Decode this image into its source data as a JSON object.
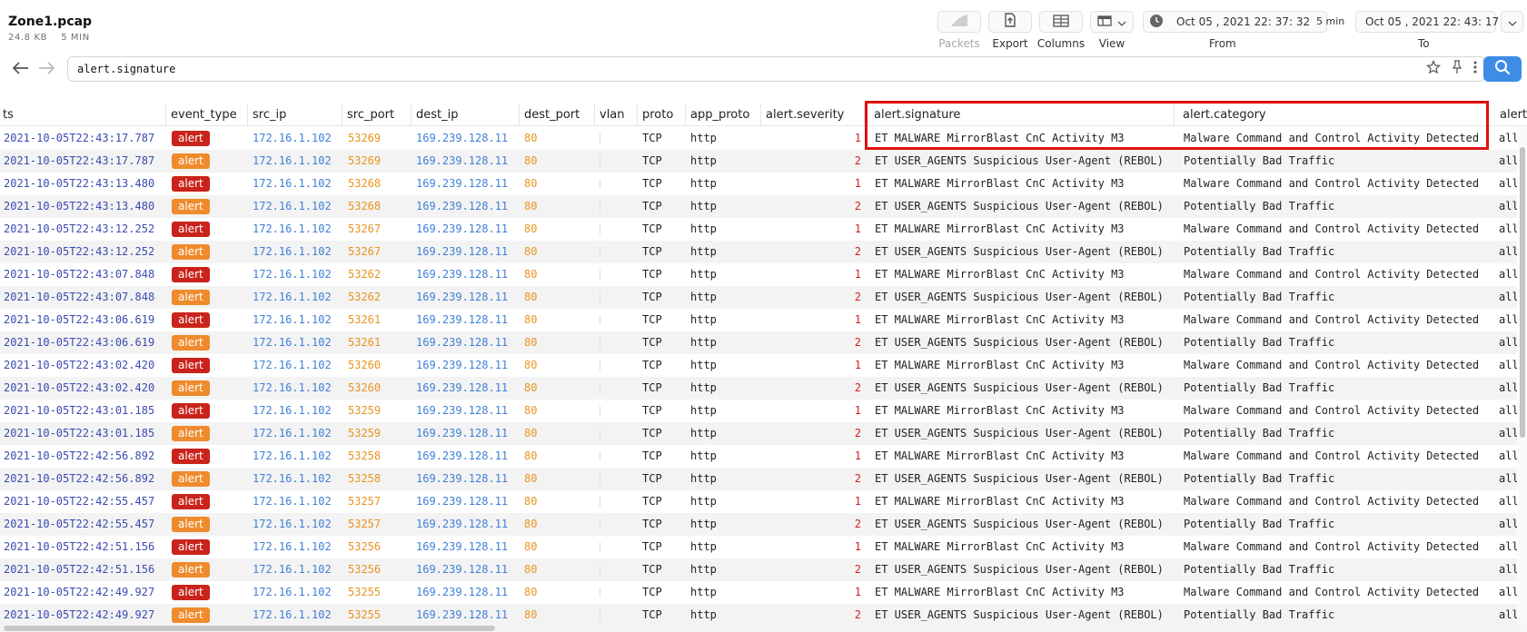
{
  "file": {
    "title": "Zone1.pcap",
    "size": "24.8 KB",
    "duration": "5 MIN"
  },
  "toolbar": {
    "packets_label": "Packets",
    "export_label": "Export",
    "columns_label": "Columns",
    "view_label": "View",
    "from_value": "Oct 05 , 2021  22: 37: 32",
    "duration_value": "5 min",
    "to_value": "Oct 05 , 2021  22: 43: 17",
    "from_label": "From",
    "to_label": "To"
  },
  "search": {
    "query": "alert.signature"
  },
  "table": {
    "columns": [
      "ts",
      "event_type",
      "src_ip",
      "src_port",
      "dest_ip",
      "dest_port",
      "vlan",
      "proto",
      "app_proto",
      "alert.severity",
      "alert.signature",
      "alert.category",
      "alert"
    ],
    "colors": {
      "sev1_badge": "#c9231b",
      "sev2_badge": "#ef8b2c",
      "highlight": "#e01010"
    },
    "rows": [
      {
        "ts": "2021-10-05T22:43:17.787",
        "event_type": "alert",
        "src_ip": "172.16.1.102",
        "src_port": "53269",
        "dest_ip": "169.239.128.11",
        "dest_port": "80",
        "vlan": "",
        "proto": "TCP",
        "app_proto": "http",
        "severity": "1",
        "signature": "ET MALWARE MirrorBlast CnC Activity M3",
        "category": "Malware Command and Control Activity Detected",
        "alert_more": "all"
      },
      {
        "ts": "2021-10-05T22:43:17.787",
        "event_type": "alert",
        "src_ip": "172.16.1.102",
        "src_port": "53269",
        "dest_ip": "169.239.128.11",
        "dest_port": "80",
        "vlan": "",
        "proto": "TCP",
        "app_proto": "http",
        "severity": "2",
        "signature": "ET USER_AGENTS Suspicious User-Agent (REBOL)",
        "category": "Potentially Bad Traffic",
        "alert_more": "all"
      },
      {
        "ts": "2021-10-05T22:43:13.480",
        "event_type": "alert",
        "src_ip": "172.16.1.102",
        "src_port": "53268",
        "dest_ip": "169.239.128.11",
        "dest_port": "80",
        "vlan": "",
        "proto": "TCP",
        "app_proto": "http",
        "severity": "1",
        "signature": "ET MALWARE MirrorBlast CnC Activity M3",
        "category": "Malware Command and Control Activity Detected",
        "alert_more": "all"
      },
      {
        "ts": "2021-10-05T22:43:13.480",
        "event_type": "alert",
        "src_ip": "172.16.1.102",
        "src_port": "53268",
        "dest_ip": "169.239.128.11",
        "dest_port": "80",
        "vlan": "",
        "proto": "TCP",
        "app_proto": "http",
        "severity": "2",
        "signature": "ET USER_AGENTS Suspicious User-Agent (REBOL)",
        "category": "Potentially Bad Traffic",
        "alert_more": "all"
      },
      {
        "ts": "2021-10-05T22:43:12.252",
        "event_type": "alert",
        "src_ip": "172.16.1.102",
        "src_port": "53267",
        "dest_ip": "169.239.128.11",
        "dest_port": "80",
        "vlan": "",
        "proto": "TCP",
        "app_proto": "http",
        "severity": "1",
        "signature": "ET MALWARE MirrorBlast CnC Activity M3",
        "category": "Malware Command and Control Activity Detected",
        "alert_more": "all"
      },
      {
        "ts": "2021-10-05T22:43:12.252",
        "event_type": "alert",
        "src_ip": "172.16.1.102",
        "src_port": "53267",
        "dest_ip": "169.239.128.11",
        "dest_port": "80",
        "vlan": "",
        "proto": "TCP",
        "app_proto": "http",
        "severity": "2",
        "signature": "ET USER_AGENTS Suspicious User-Agent (REBOL)",
        "category": "Potentially Bad Traffic",
        "alert_more": "all"
      },
      {
        "ts": "2021-10-05T22:43:07.848",
        "event_type": "alert",
        "src_ip": "172.16.1.102",
        "src_port": "53262",
        "dest_ip": "169.239.128.11",
        "dest_port": "80",
        "vlan": "",
        "proto": "TCP",
        "app_proto": "http",
        "severity": "1",
        "signature": "ET MALWARE MirrorBlast CnC Activity M3",
        "category": "Malware Command and Control Activity Detected",
        "alert_more": "all"
      },
      {
        "ts": "2021-10-05T22:43:07.848",
        "event_type": "alert",
        "src_ip": "172.16.1.102",
        "src_port": "53262",
        "dest_ip": "169.239.128.11",
        "dest_port": "80",
        "vlan": "",
        "proto": "TCP",
        "app_proto": "http",
        "severity": "2",
        "signature": "ET USER_AGENTS Suspicious User-Agent (REBOL)",
        "category": "Potentially Bad Traffic",
        "alert_more": "all"
      },
      {
        "ts": "2021-10-05T22:43:06.619",
        "event_type": "alert",
        "src_ip": "172.16.1.102",
        "src_port": "53261",
        "dest_ip": "169.239.128.11",
        "dest_port": "80",
        "vlan": "",
        "proto": "TCP",
        "app_proto": "http",
        "severity": "1",
        "signature": "ET MALWARE MirrorBlast CnC Activity M3",
        "category": "Malware Command and Control Activity Detected",
        "alert_more": "all"
      },
      {
        "ts": "2021-10-05T22:43:06.619",
        "event_type": "alert",
        "src_ip": "172.16.1.102",
        "src_port": "53261",
        "dest_ip": "169.239.128.11",
        "dest_port": "80",
        "vlan": "",
        "proto": "TCP",
        "app_proto": "http",
        "severity": "2",
        "signature": "ET USER_AGENTS Suspicious User-Agent (REBOL)",
        "category": "Potentially Bad Traffic",
        "alert_more": "all"
      },
      {
        "ts": "2021-10-05T22:43:02.420",
        "event_type": "alert",
        "src_ip": "172.16.1.102",
        "src_port": "53260",
        "dest_ip": "169.239.128.11",
        "dest_port": "80",
        "vlan": "",
        "proto": "TCP",
        "app_proto": "http",
        "severity": "1",
        "signature": "ET MALWARE MirrorBlast CnC Activity M3",
        "category": "Malware Command and Control Activity Detected",
        "alert_more": "all"
      },
      {
        "ts": "2021-10-05T22:43:02.420",
        "event_type": "alert",
        "src_ip": "172.16.1.102",
        "src_port": "53260",
        "dest_ip": "169.239.128.11",
        "dest_port": "80",
        "vlan": "",
        "proto": "TCP",
        "app_proto": "http",
        "severity": "2",
        "signature": "ET USER_AGENTS Suspicious User-Agent (REBOL)",
        "category": "Potentially Bad Traffic",
        "alert_more": "all"
      },
      {
        "ts": "2021-10-05T22:43:01.185",
        "event_type": "alert",
        "src_ip": "172.16.1.102",
        "src_port": "53259",
        "dest_ip": "169.239.128.11",
        "dest_port": "80",
        "vlan": "",
        "proto": "TCP",
        "app_proto": "http",
        "severity": "1",
        "signature": "ET MALWARE MirrorBlast CnC Activity M3",
        "category": "Malware Command and Control Activity Detected",
        "alert_more": "all"
      },
      {
        "ts": "2021-10-05T22:43:01.185",
        "event_type": "alert",
        "src_ip": "172.16.1.102",
        "src_port": "53259",
        "dest_ip": "169.239.128.11",
        "dest_port": "80",
        "vlan": "",
        "proto": "TCP",
        "app_proto": "http",
        "severity": "2",
        "signature": "ET USER_AGENTS Suspicious User-Agent (REBOL)",
        "category": "Potentially Bad Traffic",
        "alert_more": "all"
      },
      {
        "ts": "2021-10-05T22:42:56.892",
        "event_type": "alert",
        "src_ip": "172.16.1.102",
        "src_port": "53258",
        "dest_ip": "169.239.128.11",
        "dest_port": "80",
        "vlan": "",
        "proto": "TCP",
        "app_proto": "http",
        "severity": "1",
        "signature": "ET MALWARE MirrorBlast CnC Activity M3",
        "category": "Malware Command and Control Activity Detected",
        "alert_more": "all"
      },
      {
        "ts": "2021-10-05T22:42:56.892",
        "event_type": "alert",
        "src_ip": "172.16.1.102",
        "src_port": "53258",
        "dest_ip": "169.239.128.11",
        "dest_port": "80",
        "vlan": "",
        "proto": "TCP",
        "app_proto": "http",
        "severity": "2",
        "signature": "ET USER_AGENTS Suspicious User-Agent (REBOL)",
        "category": "Potentially Bad Traffic",
        "alert_more": "all"
      },
      {
        "ts": "2021-10-05T22:42:55.457",
        "event_type": "alert",
        "src_ip": "172.16.1.102",
        "src_port": "53257",
        "dest_ip": "169.239.128.11",
        "dest_port": "80",
        "vlan": "",
        "proto": "TCP",
        "app_proto": "http",
        "severity": "1",
        "signature": "ET MALWARE MirrorBlast CnC Activity M3",
        "category": "Malware Command and Control Activity Detected",
        "alert_more": "all"
      },
      {
        "ts": "2021-10-05T22:42:55.457",
        "event_type": "alert",
        "src_ip": "172.16.1.102",
        "src_port": "53257",
        "dest_ip": "169.239.128.11",
        "dest_port": "80",
        "vlan": "",
        "proto": "TCP",
        "app_proto": "http",
        "severity": "2",
        "signature": "ET USER_AGENTS Suspicious User-Agent (REBOL)",
        "category": "Potentially Bad Traffic",
        "alert_more": "all"
      },
      {
        "ts": "2021-10-05T22:42:51.156",
        "event_type": "alert",
        "src_ip": "172.16.1.102",
        "src_port": "53256",
        "dest_ip": "169.239.128.11",
        "dest_port": "80",
        "vlan": "",
        "proto": "TCP",
        "app_proto": "http",
        "severity": "1",
        "signature": "ET MALWARE MirrorBlast CnC Activity M3",
        "category": "Malware Command and Control Activity Detected",
        "alert_more": "all"
      },
      {
        "ts": "2021-10-05T22:42:51.156",
        "event_type": "alert",
        "src_ip": "172.16.1.102",
        "src_port": "53256",
        "dest_ip": "169.239.128.11",
        "dest_port": "80",
        "vlan": "",
        "proto": "TCP",
        "app_proto": "http",
        "severity": "2",
        "signature": "ET USER_AGENTS Suspicious User-Agent (REBOL)",
        "category": "Potentially Bad Traffic",
        "alert_more": "all"
      },
      {
        "ts": "2021-10-05T22:42:49.927",
        "event_type": "alert",
        "src_ip": "172.16.1.102",
        "src_port": "53255",
        "dest_ip": "169.239.128.11",
        "dest_port": "80",
        "vlan": "",
        "proto": "TCP",
        "app_proto": "http",
        "severity": "1",
        "signature": "ET MALWARE MirrorBlast CnC Activity M3",
        "category": "Malware Command and Control Activity Detected",
        "alert_more": "all"
      },
      {
        "ts": "2021-10-05T22:42:49.927",
        "event_type": "alert",
        "src_ip": "172.16.1.102",
        "src_port": "53255",
        "dest_ip": "169.239.128.11",
        "dest_port": "80",
        "vlan": "",
        "proto": "TCP",
        "app_proto": "http",
        "severity": "2",
        "signature": "ET USER_AGENTS Suspicious User-Agent (REBOL)",
        "category": "Potentially Bad Traffic",
        "alert_more": "all"
      }
    ]
  }
}
